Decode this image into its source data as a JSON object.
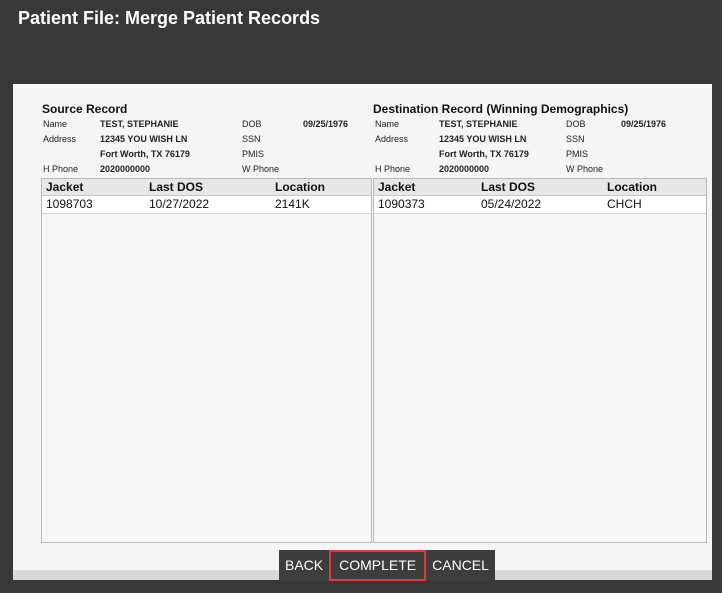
{
  "title": "Patient File: Merge Patient Records",
  "source": {
    "heading": "Source Record",
    "labels": {
      "name": "Name",
      "address": "Address",
      "hphone": "H Phone",
      "dob": "DOB",
      "ssn": "SSN",
      "pmis": "PMIS",
      "wphone": "W Phone"
    },
    "name": "TEST, STEPHANIE",
    "address1": "12345 YOU WISH LN",
    "address2": "Fort Worth, TX 76179",
    "hphone": "2020000000",
    "dob": "09/25/1976",
    "columns": [
      "Jacket",
      "Last DOS",
      "Location"
    ],
    "rows": [
      [
        "1098703",
        "10/27/2022",
        "2141K"
      ]
    ]
  },
  "destination": {
    "heading": "Destination Record (Winning Demographics)",
    "labels": {
      "name": "Name",
      "address": "Address",
      "hphone": "H Phone",
      "dob": "DOB",
      "ssn": "SSN",
      "pmis": "PMIS",
      "wphone": "W Phone"
    },
    "name": "TEST, STEPHANIE",
    "address1": "12345 YOU WISH LN",
    "address2": "Fort Worth, TX 76179",
    "hphone": "2020000000",
    "dob": "09/25/1976",
    "columns": [
      "Jacket",
      "Last DOS",
      "Location"
    ],
    "rows": [
      [
        "1090373",
        "05/24/2022",
        "CHCH"
      ]
    ]
  },
  "buttons": {
    "back": "BACK",
    "complete": "COMPLETE",
    "cancel": "CANCEL"
  },
  "colors": {
    "highlight": "#e0383e"
  }
}
